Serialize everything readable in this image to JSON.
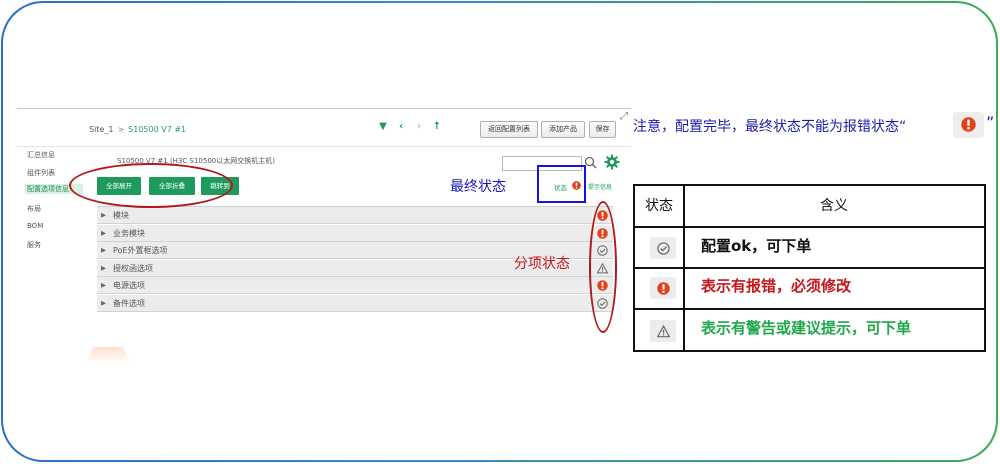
{
  "colors": {
    "frame_left": "#2b6fc2",
    "frame_right": "#3aab58",
    "green_button": "#1e9b5c",
    "error_icon": "#e0421b",
    "annotation_red": "#b01a1a",
    "annotation_blue": "#1414d8",
    "note_text": "#1c1ca8",
    "meaning_ok": "#111111",
    "meaning_error": "#c3171b",
    "meaning_warning": "#1fa84a"
  },
  "header": {
    "breadcrumb_site": "Site_1",
    "breadcrumb_separator": ">",
    "breadcrumb_current": "S10500 V7 #1",
    "nav_icons": [
      "triangle-down-icon",
      "chevron-left-icon",
      "chevron-right-icon",
      "arrow-up-icon"
    ],
    "buttons": {
      "back_to_list": "返回配置列表",
      "add_product": "添加产品",
      "save": "保存"
    }
  },
  "sidebar": {
    "items": [
      {
        "label": "汇总信息"
      },
      {
        "label": "组件列表"
      },
      {
        "label": "配置选项信息"
      },
      {
        "label": "布局"
      },
      {
        "label": "BOM"
      },
      {
        "label": "服务"
      }
    ]
  },
  "config": {
    "title": "S10500 V7 #1 (H3C S10500以太网交换机主机)",
    "buttons": {
      "expand_all": "全部展开",
      "collapse_all": "全部折叠",
      "jump": "跳转到"
    },
    "status_label": "状态",
    "tip_label": "提示信息",
    "rows": [
      {
        "label": "模块",
        "status": "error-icon"
      },
      {
        "label": "业务模块",
        "status": "error-icon"
      },
      {
        "label": "PoE外置框选项",
        "status": "ok-icon"
      },
      {
        "label": "授权函选项",
        "status": "warning-icon"
      },
      {
        "label": "电源选项",
        "status": "error-icon"
      },
      {
        "label": "备件选项",
        "status": "ok-icon"
      }
    ]
  },
  "annotations": {
    "final_status": "最终状态",
    "sub_status": "分项状态",
    "note": "注意，配置完毕，最终状态不能为报错状态“",
    "note_close": "”"
  },
  "legend": {
    "col_status": "状态",
    "col_meaning": "含义",
    "rows": [
      {
        "icon": "ok-icon",
        "meaning": "配置ok，可下单"
      },
      {
        "icon": "error-icon",
        "meaning": "表示有报错，必须修改"
      },
      {
        "icon": "warning-icon",
        "meaning": "表示有警告或建议提示，可下单"
      }
    ]
  }
}
